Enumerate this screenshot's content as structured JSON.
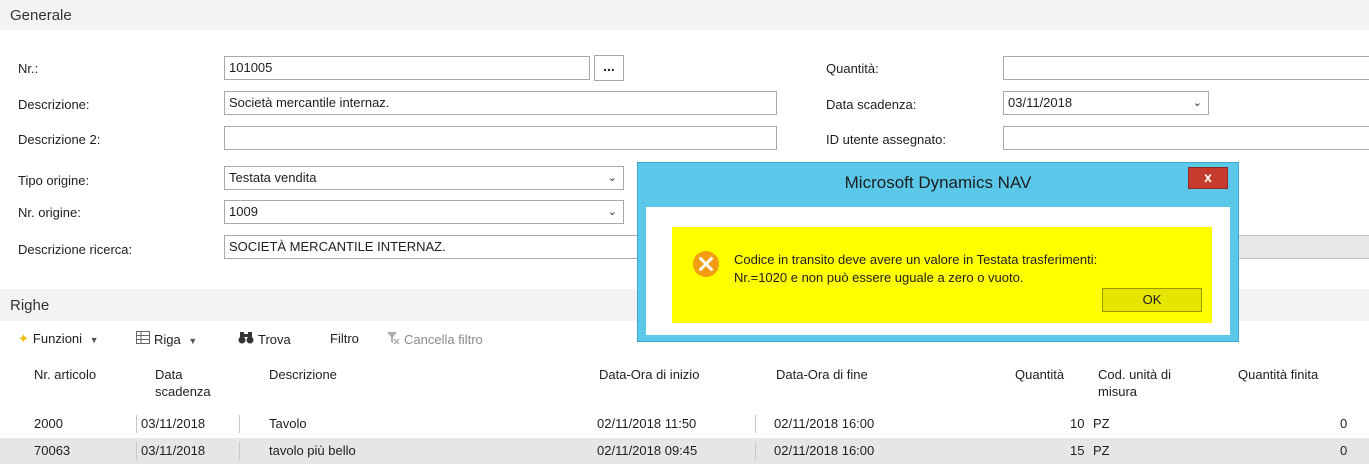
{
  "general": {
    "title": "Generale",
    "labels": {
      "nr": "Nr.:",
      "descrizione": "Descrizione:",
      "descrizione2": "Descrizione 2:",
      "tipo_origine": "Tipo origine:",
      "nr_origine": "Nr. origine:",
      "descrizione_ricerca": "Descrizione ricerca:",
      "quantita": "Quantità:",
      "data_scadenza": "Data scadenza:",
      "id_utente": "ID utente assegnato:"
    },
    "values": {
      "nr": "101005",
      "descrizione": "Società mercantile internaz.",
      "descrizione2": "",
      "tipo_origine": "Testata vendita",
      "nr_origine": "1009",
      "descrizione_ricerca": "SOCIETÀ MERCANTILE INTERNAZ.",
      "quantita": "",
      "data_scadenza": "03/11/2018",
      "id_utente": ""
    },
    "assist_button": "..."
  },
  "righe": {
    "title": "Righe",
    "toolbar": {
      "funzioni": "Funzioni",
      "riga": "Riga",
      "trova": "Trova",
      "filtro": "Filtro",
      "cancella_filtro": "Cancella filtro"
    },
    "columns": {
      "nr_articolo": "Nr. articolo",
      "data_scadenza_1": "Data",
      "data_scadenza_2": "scadenza",
      "descrizione": "Descrizione",
      "data_inizio": "Data-Ora di inizio",
      "data_fine": "Data-Ora di fine",
      "quantita": "Quantità",
      "cod_unita_1": "Cod. unità di",
      "cod_unita_2": "misura",
      "quantita_finita": "Quantità finita"
    },
    "rows": [
      {
        "nr": "2000",
        "data": "03/11/2018",
        "descrizione": "Tavolo",
        "inizio": "02/11/2018 11:50",
        "fine": "02/11/2018 16:00",
        "quantita": "10",
        "unita": "PZ",
        "finita": "0"
      },
      {
        "nr": "70063",
        "data": "03/11/2018",
        "descrizione": "tavolo più bello",
        "inizio": "02/11/2018 09:45",
        "fine": "02/11/2018 16:00",
        "quantita": "15",
        "unita": "PZ",
        "finita": "0"
      }
    ]
  },
  "dialog": {
    "title": "Microsoft Dynamics NAV",
    "close": "x",
    "message_line1": "Codice in transito deve avere un valore in Testata trasferimenti:",
    "message_line2": "Nr.=1020 e non può essere uguale a zero o vuoto.",
    "ok": "OK"
  },
  "colors": {
    "dialog_frame": "#5bc8ea",
    "dialog_highlight": "#ffff00",
    "close_button": "#c53c2c",
    "error_icon": "#f39c12",
    "selected_row": "#e6e6e6"
  }
}
